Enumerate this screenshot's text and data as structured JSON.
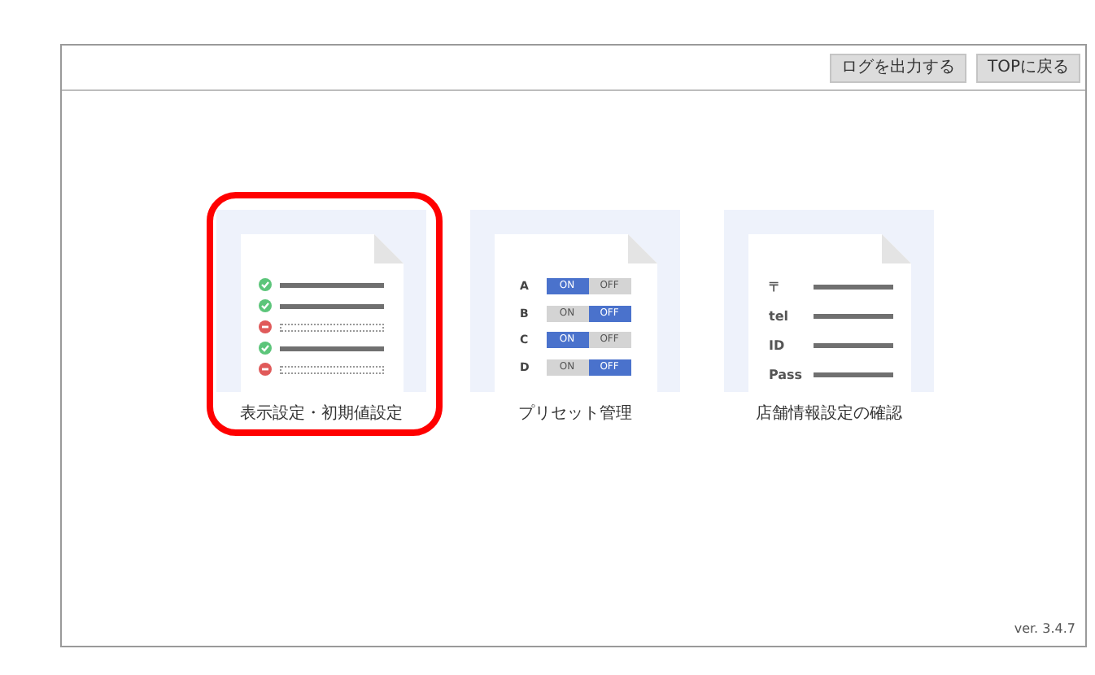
{
  "header": {
    "buttons": [
      "ログを出力する",
      "TOPに戻る"
    ]
  },
  "cards": [
    {
      "kind": "checklist",
      "label": "表示設定・初期値設定",
      "selected": true,
      "rows": [
        {
          "checked": true
        },
        {
          "checked": true
        },
        {
          "checked": false
        },
        {
          "checked": true
        },
        {
          "checked": false
        }
      ]
    },
    {
      "kind": "toggles",
      "label": "プリセット管理",
      "selected": false,
      "rows": [
        {
          "name": "A",
          "on_label": "ON",
          "off_label": "OFF",
          "on": true
        },
        {
          "name": "B",
          "on_label": "ON",
          "off_label": "OFF",
          "on": false
        },
        {
          "name": "C",
          "on_label": "ON",
          "off_label": "OFF",
          "on": true
        },
        {
          "name": "D",
          "on_label": "ON",
          "off_label": "OFF",
          "on": false
        }
      ]
    },
    {
      "kind": "fields",
      "label": "店舗情報設定の確認",
      "selected": false,
      "rows": [
        {
          "name": "〒"
        },
        {
          "name": "tel"
        },
        {
          "name": "ID"
        },
        {
          "name": "Pass"
        }
      ]
    }
  ],
  "version": "ver. 3.4.7"
}
